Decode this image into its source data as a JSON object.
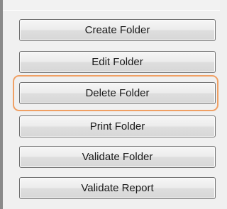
{
  "buttons": {
    "create_folder": "Create Folder",
    "edit_folder": "Edit Folder",
    "delete_folder": "Delete Folder",
    "print_folder": "Print Folder",
    "validate_folder": "Validate Folder",
    "validate_report": "Validate Report"
  },
  "highlight": {
    "target": "delete_folder",
    "color": "#f0a064"
  },
  "colors": {
    "background": "#f0f0f0",
    "button_border": "#707070",
    "text": "#1a1a1a"
  }
}
